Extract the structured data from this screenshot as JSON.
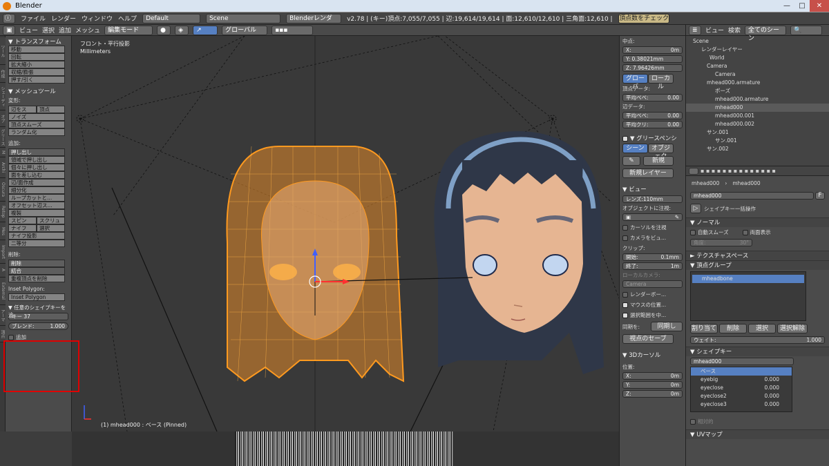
{
  "title": "Blender",
  "menus": [
    "ファイル",
    "レンダー",
    "ウィンドウ",
    "ヘルプ"
  ],
  "layout": "Default",
  "scene": "Scene",
  "engine": "Blenderレンダー",
  "stats": "v2.78 | (キー)頂点:7,055/7,055 | 辺:19,614/19,614 | 面:12,610/12,610 | 三角面:12,610 | メモリ:128.33M | mhead000",
  "check_button": "頂点数をチェック",
  "view_header": {
    "items": [
      "ビュー",
      "選択",
      "追加",
      "メッシュ"
    ],
    "mode": "編集モード",
    "orientation": "グローバル"
  },
  "left_tabs": [
    "ツール",
    "作成",
    "シェーディ",
    "オプ",
    "グリース",
    "M",
    "Archi",
    "Oscura",
    "Retop",
    "Mes",
    "Import",
    "A",
    "External",
    "アーマ",
    "頂点"
  ],
  "toolshelf": {
    "transform_header": "▼ トランスフォーム",
    "transform": [
      "移動",
      "回転",
      "拡大縮小",
      "収縮/膨張",
      "押す/引く"
    ],
    "meshtools_header": "▼ メッシュツール",
    "deform_label": "変形:",
    "deform_pair": [
      "辺をス",
      "頂点"
    ],
    "deform": [
      "ノイズ",
      "頂点スムーズ",
      "ランダム化"
    ],
    "add_label": "追加:",
    "extrude": "押し出し",
    "add": [
      "領域で押し出し",
      "個々に押し出し",
      "面を差し込む",
      "辺/面作成",
      "細分化",
      "ループカットと...",
      "オフセット辺ス...",
      "複製"
    ],
    "spin": [
      "スピン",
      "スクリュ"
    ],
    "knife": [
      "ナイフ",
      "選択"
    ],
    "add2": [
      "ナイフ投影",
      "二等分"
    ],
    "remove_label": "削除:",
    "delete": "削除",
    "merge": "結合",
    "remove_doubles": "重複頂点を削除",
    "inset_label": "Inset Polygon:",
    "inset_btn": "Inset Polygon",
    "redo_header": "▼ 任意のシェイプキーを追",
    "key_field": "キー 37",
    "blend_label": "ブレンド:",
    "blend_value": "1.000",
    "add_check": "追加"
  },
  "viewport": {
    "view_name": "フロント・平行投影",
    "units": "Millimeters",
    "status": "(1) mhead000 : ベース (Pinned)"
  },
  "npanel": {
    "median_label": "中点:",
    "x": "X:",
    "x_val": "0m",
    "y": "Y: 0.38021mm",
    "z": "Z: 7.96426mm",
    "global": "グローバ",
    "local": "ローカル",
    "vertex_data": "頂点データ:",
    "mean_bevel": "平均ベベ:",
    "mean_bevel_val": "0.00",
    "edge_data": "辺データ:",
    "mean_bevel2": "平均ベベ:",
    "mean_bevel2_val": "0.00",
    "mean_crease": "平均クリ:",
    "mean_crease_val": "0.00",
    "grease_header": "▼ グリースペンシ",
    "scene_btn": "シーン",
    "object_btn": "オブジェク",
    "new_btn": "新規",
    "new_layer": "新規レイヤー",
    "view_header": "▼ ビュー",
    "lens": "レンズ:110mm",
    "lock_label": "オブジェクトに注視:",
    "lock_cursor": "カーソルを注視",
    "lock_camera": "カメラをビュ...",
    "clip_label": "クリップ:",
    "clip_start": "開始:",
    "clip_start_val": "0.1mm",
    "clip_end": "終了:",
    "clip_end_val": "1m",
    "local_camera": "ローカルカメラ:",
    "camera": "Camera",
    "render_border": "レンダーボー...",
    "mouse_pos": "マウスの位置...",
    "select_center": "選択範囲を中...",
    "sync_label": "同期を:",
    "sync_val": "同期し",
    "save_view": "視点のセーブ",
    "cursor_header": "▼ 3Dカーソル",
    "position": "位置:",
    "cx": "X:",
    "cx_val": "0m",
    "cy": "Y:",
    "cy_val": "0m",
    "cz": "Z:",
    "cz_val": "0m"
  },
  "outliner": {
    "view": "ビュー",
    "search": "検索",
    "filter": "全てのシーン",
    "rows": [
      "Scene",
      "レンダーレイヤー",
      "World",
      "Camera",
      "Camera",
      "mhead000.armature",
      "ポーズ",
      "mhead000.armature",
      "mhead000",
      "mhead000.001",
      "mhead000.002",
      "サン.001",
      "サン.001",
      "サン.002"
    ]
  },
  "properties": {
    "breadcrumb1": "mhead000",
    "breadcrumb2": "mhead000",
    "name": "mhead000",
    "f_btn": "F",
    "shapekey_op": "シェイプキー一括操作",
    "normals_header": "▼ ノーマル",
    "autosmooth": "自動スムーズ",
    "double_sided": "両面表示",
    "angle": "角度:",
    "angle_val": "30°",
    "texspace_header": "► テクスチャスペース",
    "vgroups_header": "▼ 頂点グループ",
    "vgroup": "mheadbone",
    "assign": "割り当て",
    "remove": "削除",
    "select": "選択",
    "deselect": "選択解除",
    "weight": "ウェイト:",
    "weight_val": "1.000",
    "shapekeys_header": "▼ シェイプキー",
    "sk_name": "mhead000",
    "shapekeys": [
      {
        "name": "ベース",
        "value": ""
      },
      {
        "name": "eyebig",
        "value": "0.000"
      },
      {
        "name": "eyeclose",
        "value": "0.000"
      },
      {
        "name": "eyeclose2",
        "value": "0.000"
      },
      {
        "name": "eyeclose3",
        "value": "0.000"
      }
    ],
    "relative": "相対的",
    "uv_header": "▼ UVマップ"
  },
  "colors": {
    "accent_blue": "#5680c2",
    "orange": "#ff9a1f",
    "red_box": "#e00000"
  }
}
